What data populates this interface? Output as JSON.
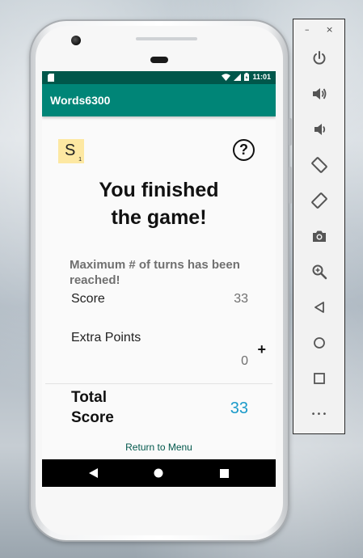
{
  "app": {
    "title": "Words6300"
  },
  "status_bar": {
    "time": "11:01"
  },
  "tile": {
    "letter": "S",
    "points": "1"
  },
  "help": {
    "label": "?"
  },
  "headline": {
    "line1": "You finished",
    "line2": "the game!"
  },
  "reason": {
    "text": "Maximum # of turns has been reached!"
  },
  "score": {
    "label": "Score",
    "value": "33"
  },
  "extra_points": {
    "label": "Extra Points",
    "value": "0",
    "sign": "+"
  },
  "total": {
    "label_line1": "Total",
    "label_line2": "Score",
    "value": "33"
  },
  "return_link": {
    "label": "Return to Menu"
  },
  "emulator_toolbar": {
    "window_controls": [
      "–",
      "×"
    ],
    "tools": [
      "power-icon",
      "volume-up-icon",
      "volume-down-icon",
      "rotate-left-icon",
      "rotate-right-icon",
      "camera-icon",
      "zoom-icon",
      "back-icon",
      "home-icon",
      "overview-icon",
      "more-icon"
    ],
    "more_label": "•••"
  },
  "colors": {
    "app_bar": "#008577",
    "status_bar": "#00574b",
    "tile": "#fde8a2",
    "total_value": "#1a9ac9",
    "link": "#00574b"
  }
}
